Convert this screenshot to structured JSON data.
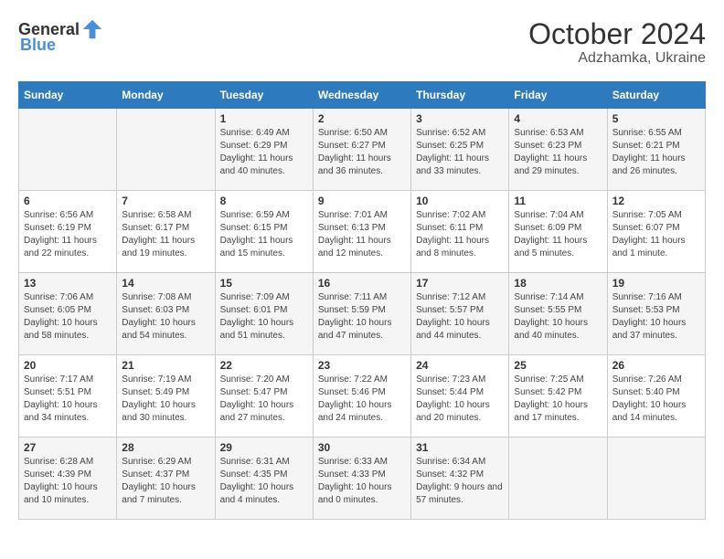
{
  "header": {
    "logo_general": "General",
    "logo_blue": "Blue",
    "month_year": "October 2024",
    "location": "Adzhamka, Ukraine"
  },
  "days_of_week": [
    "Sunday",
    "Monday",
    "Tuesday",
    "Wednesday",
    "Thursday",
    "Friday",
    "Saturday"
  ],
  "weeks": [
    [
      {
        "day": "",
        "content": ""
      },
      {
        "day": "",
        "content": ""
      },
      {
        "day": "1",
        "content": "Sunrise: 6:49 AM\nSunset: 6:29 PM\nDaylight: 11 hours and 40 minutes."
      },
      {
        "day": "2",
        "content": "Sunrise: 6:50 AM\nSunset: 6:27 PM\nDaylight: 11 hours and 36 minutes."
      },
      {
        "day": "3",
        "content": "Sunrise: 6:52 AM\nSunset: 6:25 PM\nDaylight: 11 hours and 33 minutes."
      },
      {
        "day": "4",
        "content": "Sunrise: 6:53 AM\nSunset: 6:23 PM\nDaylight: 11 hours and 29 minutes."
      },
      {
        "day": "5",
        "content": "Sunrise: 6:55 AM\nSunset: 6:21 PM\nDaylight: 11 hours and 26 minutes."
      }
    ],
    [
      {
        "day": "6",
        "content": "Sunrise: 6:56 AM\nSunset: 6:19 PM\nDaylight: 11 hours and 22 minutes."
      },
      {
        "day": "7",
        "content": "Sunrise: 6:58 AM\nSunset: 6:17 PM\nDaylight: 11 hours and 19 minutes."
      },
      {
        "day": "8",
        "content": "Sunrise: 6:59 AM\nSunset: 6:15 PM\nDaylight: 11 hours and 15 minutes."
      },
      {
        "day": "9",
        "content": "Sunrise: 7:01 AM\nSunset: 6:13 PM\nDaylight: 11 hours and 12 minutes."
      },
      {
        "day": "10",
        "content": "Sunrise: 7:02 AM\nSunset: 6:11 PM\nDaylight: 11 hours and 8 minutes."
      },
      {
        "day": "11",
        "content": "Sunrise: 7:04 AM\nSunset: 6:09 PM\nDaylight: 11 hours and 5 minutes."
      },
      {
        "day": "12",
        "content": "Sunrise: 7:05 AM\nSunset: 6:07 PM\nDaylight: 11 hours and 1 minute."
      }
    ],
    [
      {
        "day": "13",
        "content": "Sunrise: 7:06 AM\nSunset: 6:05 PM\nDaylight: 10 hours and 58 minutes."
      },
      {
        "day": "14",
        "content": "Sunrise: 7:08 AM\nSunset: 6:03 PM\nDaylight: 10 hours and 54 minutes."
      },
      {
        "day": "15",
        "content": "Sunrise: 7:09 AM\nSunset: 6:01 PM\nDaylight: 10 hours and 51 minutes."
      },
      {
        "day": "16",
        "content": "Sunrise: 7:11 AM\nSunset: 5:59 PM\nDaylight: 10 hours and 47 minutes."
      },
      {
        "day": "17",
        "content": "Sunrise: 7:12 AM\nSunset: 5:57 PM\nDaylight: 10 hours and 44 minutes."
      },
      {
        "day": "18",
        "content": "Sunrise: 7:14 AM\nSunset: 5:55 PM\nDaylight: 10 hours and 40 minutes."
      },
      {
        "day": "19",
        "content": "Sunrise: 7:16 AM\nSunset: 5:53 PM\nDaylight: 10 hours and 37 minutes."
      }
    ],
    [
      {
        "day": "20",
        "content": "Sunrise: 7:17 AM\nSunset: 5:51 PM\nDaylight: 10 hours and 34 minutes."
      },
      {
        "day": "21",
        "content": "Sunrise: 7:19 AM\nSunset: 5:49 PM\nDaylight: 10 hours and 30 minutes."
      },
      {
        "day": "22",
        "content": "Sunrise: 7:20 AM\nSunset: 5:47 PM\nDaylight: 10 hours and 27 minutes."
      },
      {
        "day": "23",
        "content": "Sunrise: 7:22 AM\nSunset: 5:46 PM\nDaylight: 10 hours and 24 minutes."
      },
      {
        "day": "24",
        "content": "Sunrise: 7:23 AM\nSunset: 5:44 PM\nDaylight: 10 hours and 20 minutes."
      },
      {
        "day": "25",
        "content": "Sunrise: 7:25 AM\nSunset: 5:42 PM\nDaylight: 10 hours and 17 minutes."
      },
      {
        "day": "26",
        "content": "Sunrise: 7:26 AM\nSunset: 5:40 PM\nDaylight: 10 hours and 14 minutes."
      }
    ],
    [
      {
        "day": "27",
        "content": "Sunrise: 6:28 AM\nSunset: 4:39 PM\nDaylight: 10 hours and 10 minutes."
      },
      {
        "day": "28",
        "content": "Sunrise: 6:29 AM\nSunset: 4:37 PM\nDaylight: 10 hours and 7 minutes."
      },
      {
        "day": "29",
        "content": "Sunrise: 6:31 AM\nSunset: 4:35 PM\nDaylight: 10 hours and 4 minutes."
      },
      {
        "day": "30",
        "content": "Sunrise: 6:33 AM\nSunset: 4:33 PM\nDaylight: 10 hours and 0 minutes."
      },
      {
        "day": "31",
        "content": "Sunrise: 6:34 AM\nSunset: 4:32 PM\nDaylight: 9 hours and 57 minutes."
      },
      {
        "day": "",
        "content": ""
      },
      {
        "day": "",
        "content": ""
      }
    ]
  ]
}
